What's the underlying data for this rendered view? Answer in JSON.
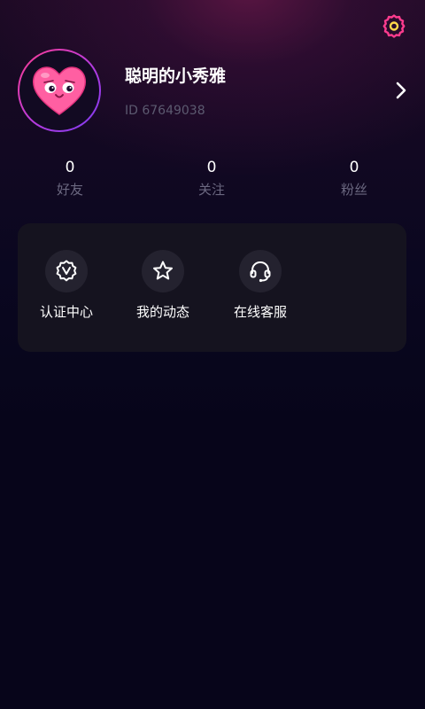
{
  "profile": {
    "username": "聪明的小秀雅",
    "id_text": "ID 67649038",
    "avatar_icon": "heart-face-icon"
  },
  "header": {
    "settings_icon": "gear-icon"
  },
  "stats": [
    {
      "value": "0",
      "label": "好友"
    },
    {
      "value": "0",
      "label": "关注"
    },
    {
      "value": "0",
      "label": "粉丝"
    }
  ],
  "tools": [
    {
      "label": "认证中心",
      "icon": "verified-badge-icon"
    },
    {
      "label": "我的动态",
      "icon": "star-icon"
    },
    {
      "label": "在线客服",
      "icon": "headset-icon"
    }
  ],
  "colors": {
    "background": "#07051a",
    "accent_pink": "#ff3c8e",
    "accent_yellow": "#ffd84a",
    "card": "#15131f",
    "muted_text": "#6b6880"
  }
}
